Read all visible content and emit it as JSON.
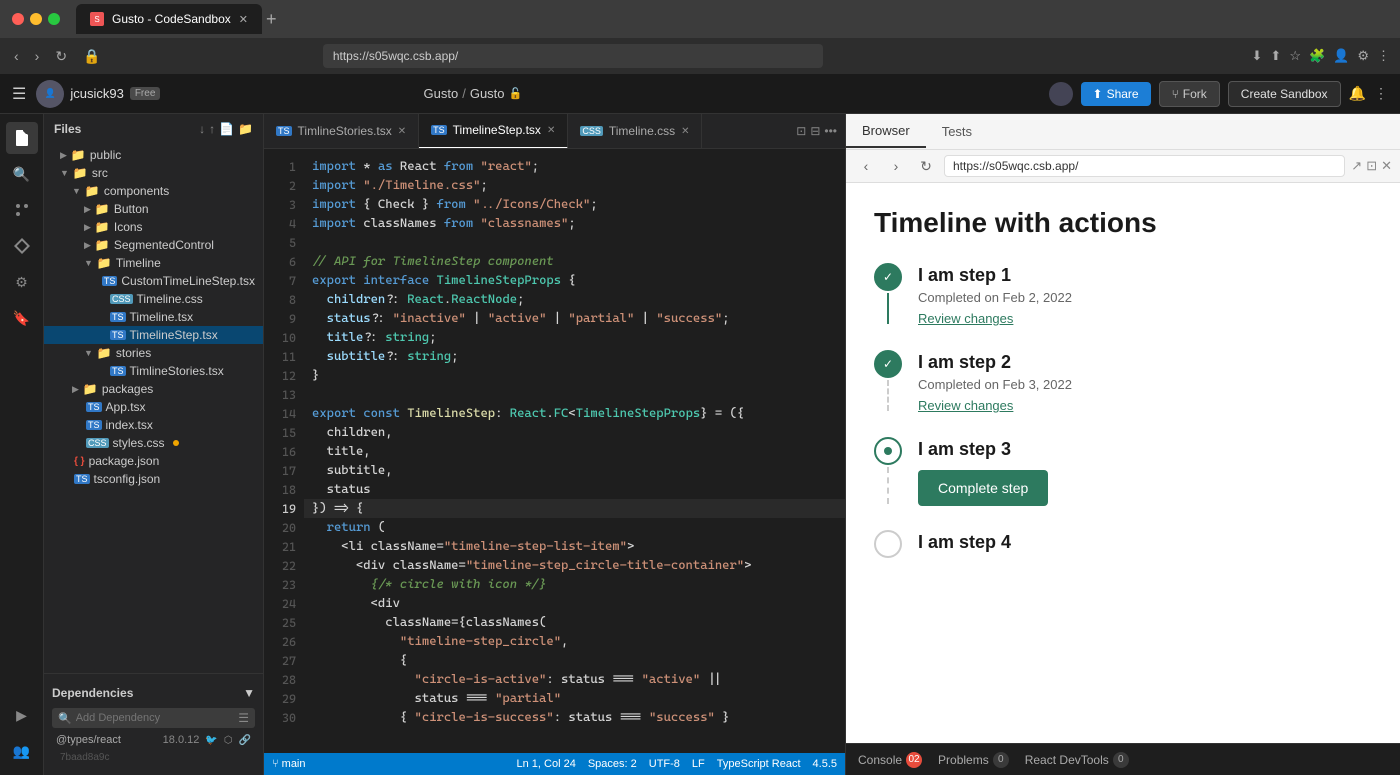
{
  "browser_chrome": {
    "traffic_lights": [
      "red",
      "yellow",
      "green"
    ],
    "tab_title": "Gusto - CodeSandbox",
    "new_tab_label": "+"
  },
  "nav_bar": {
    "url": "https://s05wqc.csb.app/"
  },
  "app_header": {
    "username": "jcusick93",
    "free_badge": "Free",
    "title_left": "Gusto",
    "title_separator": "/",
    "title_right": "Gusto",
    "share_label": "Share",
    "fork_label": "Fork",
    "create_sandbox_label": "Create Sandbox"
  },
  "file_panel": {
    "title": "Files",
    "folders": [
      {
        "name": "public",
        "indent": 1,
        "type": "folder"
      },
      {
        "name": "src",
        "indent": 1,
        "type": "folder",
        "expanded": true
      },
      {
        "name": "components",
        "indent": 2,
        "type": "folder",
        "expanded": true
      },
      {
        "name": "Button",
        "indent": 3,
        "type": "folder"
      },
      {
        "name": "Icons",
        "indent": 3,
        "type": "folder"
      },
      {
        "name": "SegmentedControl",
        "indent": 3,
        "type": "folder"
      },
      {
        "name": "Timeline",
        "indent": 3,
        "type": "folder",
        "expanded": true
      },
      {
        "name": "CustomTimeLineStep.tsx",
        "indent": 4,
        "type": "tsx"
      },
      {
        "name": "Timeline.css",
        "indent": 4,
        "type": "css"
      },
      {
        "name": "Timeline.tsx",
        "indent": 4,
        "type": "tsx"
      },
      {
        "name": "TimelineStep.tsx",
        "indent": 4,
        "type": "tsx",
        "active": true
      },
      {
        "name": "stories",
        "indent": 3,
        "type": "folder",
        "expanded": true
      },
      {
        "name": "TimlineStories.tsx",
        "indent": 4,
        "type": "tsx"
      },
      {
        "name": "packages",
        "indent": 2,
        "type": "folder"
      },
      {
        "name": "App.tsx",
        "indent": 2,
        "type": "tsx"
      },
      {
        "name": "index.tsx",
        "indent": 2,
        "type": "tsx"
      },
      {
        "name": "styles.css",
        "indent": 2,
        "type": "css",
        "dot": true
      }
    ],
    "root_files": [
      {
        "name": "package.json",
        "indent": 1,
        "type": "json"
      },
      {
        "name": "tsconfig.json",
        "indent": 1,
        "type": "json"
      }
    ],
    "dependencies_title": "Dependencies",
    "add_dependency_placeholder": "Add Dependency",
    "dependency_items": [
      {
        "name": "@types/react",
        "version": "18.0.12"
      }
    ],
    "commit_hash": "7baad8a9c"
  },
  "editor_tabs": [
    {
      "name": "TimlineStories.tsx",
      "type": "tsx",
      "active": false,
      "modified": false
    },
    {
      "name": "TimelineStep.tsx",
      "type": "tsx",
      "active": true,
      "modified": false
    },
    {
      "name": "Timeline.css",
      "type": "css",
      "active": false,
      "modified": false
    }
  ],
  "code_lines": [
    {
      "num": 1,
      "tokens": [
        {
          "t": "kw",
          "v": "import"
        },
        {
          "t": "plain",
          "v": " * "
        },
        {
          "t": "kw",
          "v": "as"
        },
        {
          "t": "plain",
          "v": " React "
        },
        {
          "t": "kw",
          "v": "from"
        },
        {
          "t": "plain",
          "v": " "
        },
        {
          "t": "str",
          "v": "\"react\""
        },
        {
          "t": "plain",
          "v": ";"
        }
      ]
    },
    {
      "num": 2,
      "tokens": [
        {
          "t": "kw",
          "v": "import"
        },
        {
          "t": "plain",
          "v": " "
        },
        {
          "t": "str",
          "v": "\"./Timeline.css\""
        },
        {
          "t": "plain",
          "v": ";"
        }
      ]
    },
    {
      "num": 3,
      "tokens": [
        {
          "t": "kw",
          "v": "import"
        },
        {
          "t": "plain",
          "v": " { Check } "
        },
        {
          "t": "kw",
          "v": "from"
        },
        {
          "t": "plain",
          "v": " "
        },
        {
          "t": "str",
          "v": "\"../Icons/Check\""
        },
        {
          "t": "plain",
          "v": ";"
        }
      ]
    },
    {
      "num": 4,
      "tokens": [
        {
          "t": "kw",
          "v": "import"
        },
        {
          "t": "plain",
          "v": " classNames "
        },
        {
          "t": "kw",
          "v": "from"
        },
        {
          "t": "plain",
          "v": " "
        },
        {
          "t": "str",
          "v": "\"classnames\""
        },
        {
          "t": "plain",
          "v": ";"
        }
      ]
    },
    {
      "num": 5,
      "tokens": []
    },
    {
      "num": 6,
      "tokens": [
        {
          "t": "cm",
          "v": "// API for TimelineStep component"
        }
      ]
    },
    {
      "num": 7,
      "tokens": [
        {
          "t": "kw",
          "v": "export"
        },
        {
          "t": "plain",
          "v": " "
        },
        {
          "t": "kw",
          "v": "interface"
        },
        {
          "t": "plain",
          "v": " "
        },
        {
          "t": "type",
          "v": "TimelineStepProps"
        },
        {
          "t": "plain",
          "v": " {"
        }
      ]
    },
    {
      "num": 8,
      "tokens": [
        {
          "t": "plain",
          "v": "  "
        },
        {
          "t": "prop",
          "v": "children"
        },
        {
          "t": "plain",
          "v": "?: "
        },
        {
          "t": "type",
          "v": "React"
        },
        {
          "t": "plain",
          "v": "."
        },
        {
          "t": "type",
          "v": "ReactNode"
        },
        {
          "t": "plain",
          "v": ";"
        }
      ]
    },
    {
      "num": 9,
      "tokens": [
        {
          "t": "plain",
          "v": "  "
        },
        {
          "t": "prop",
          "v": "status"
        },
        {
          "t": "plain",
          "v": "?: "
        },
        {
          "t": "str",
          "v": "\"inactive\""
        },
        {
          "t": "plain",
          "v": " | "
        },
        {
          "t": "str",
          "v": "\"active\""
        },
        {
          "t": "plain",
          "v": " | "
        },
        {
          "t": "str",
          "v": "\"partial\""
        },
        {
          "t": "plain",
          "v": " | "
        },
        {
          "t": "str",
          "v": "\"success\""
        },
        {
          "t": "plain",
          "v": ";"
        }
      ]
    },
    {
      "num": 10,
      "tokens": [
        {
          "t": "plain",
          "v": "  "
        },
        {
          "t": "prop",
          "v": "title"
        },
        {
          "t": "plain",
          "v": "?: "
        },
        {
          "t": "type",
          "v": "string"
        },
        {
          "t": "plain",
          "v": ";"
        }
      ]
    },
    {
      "num": 11,
      "tokens": [
        {
          "t": "plain",
          "v": "  "
        },
        {
          "t": "prop",
          "v": "subtitle"
        },
        {
          "t": "plain",
          "v": "?: "
        },
        {
          "t": "type",
          "v": "string"
        },
        {
          "t": "plain",
          "v": ";"
        }
      ]
    },
    {
      "num": 12,
      "tokens": [
        {
          "t": "plain",
          "v": "}"
        }
      ]
    },
    {
      "num": 13,
      "tokens": []
    },
    {
      "num": 14,
      "tokens": [
        {
          "t": "kw",
          "v": "export"
        },
        {
          "t": "plain",
          "v": " "
        },
        {
          "t": "kw",
          "v": "const"
        },
        {
          "t": "plain",
          "v": " "
        },
        {
          "t": "fn",
          "v": "TimelineStep"
        },
        {
          "t": "plain",
          "v": ": "
        },
        {
          "t": "type",
          "v": "React"
        },
        {
          "t": "plain",
          "v": "."
        },
        {
          "t": "type",
          "v": "FC"
        },
        {
          "t": "plain",
          "v": "<"
        },
        {
          "t": "type",
          "v": "TimelineStepProps"
        },
        {
          "t": "plain",
          "v": "} = ({"
        }
      ]
    },
    {
      "num": 15,
      "tokens": [
        {
          "t": "plain",
          "v": "  children,"
        }
      ]
    },
    {
      "num": 16,
      "tokens": [
        {
          "t": "plain",
          "v": "  title,"
        }
      ]
    },
    {
      "num": 17,
      "tokens": [
        {
          "t": "plain",
          "v": "  subtitle,"
        }
      ]
    },
    {
      "num": 18,
      "tokens": [
        {
          "t": "plain",
          "v": "  status"
        }
      ]
    },
    {
      "num": 19,
      "tokens": [
        {
          "t": "plain",
          "v": "}) => {"
        }
      ]
    },
    {
      "num": 20,
      "tokens": [
        {
          "t": "plain",
          "v": "  "
        },
        {
          "t": "kw",
          "v": "return"
        },
        {
          "t": "plain",
          "v": " ("
        }
      ]
    },
    {
      "num": 21,
      "tokens": [
        {
          "t": "plain",
          "v": "    <li className="
        },
        {
          "t": "str",
          "v": "\"timeline-step-list-item\""
        },
        {
          "t": "plain",
          "v": ">"
        }
      ]
    },
    {
      "num": 22,
      "tokens": [
        {
          "t": "plain",
          "v": "      <div className="
        },
        {
          "t": "str",
          "v": "\"timeline-step_circle-title-container\""
        },
        {
          "t": "plain",
          "v": ">"
        }
      ]
    },
    {
      "num": 23,
      "tokens": [
        {
          "t": "plain",
          "v": "        "
        },
        {
          "t": "cm",
          "v": "{/* circle with icon */}"
        }
      ]
    },
    {
      "num": 24,
      "tokens": [
        {
          "t": "plain",
          "v": "        <div"
        }
      ]
    },
    {
      "num": 25,
      "tokens": [
        {
          "t": "plain",
          "v": "          className={classNames("
        }
      ]
    },
    {
      "num": 26,
      "tokens": [
        {
          "t": "plain",
          "v": "            "
        },
        {
          "t": "str",
          "v": "\"timeline-step_circle\""
        },
        {
          "t": "plain",
          "v": ","
        }
      ]
    },
    {
      "num": 27,
      "tokens": [
        {
          "t": "plain",
          "v": "            {"
        }
      ]
    },
    {
      "num": 28,
      "tokens": [
        {
          "t": "plain",
          "v": "              "
        },
        {
          "t": "str",
          "v": "\"circle-is-active\""
        },
        {
          "t": "plain",
          "v": ": status === "
        },
        {
          "t": "str",
          "v": "\"active\""
        },
        {
          "t": "plain",
          "v": " ||"
        }
      ]
    },
    {
      "num": 29,
      "tokens": [
        {
          "t": "plain",
          "v": "              status === "
        },
        {
          "t": "str",
          "v": "\"partial\""
        }
      ]
    },
    {
      "num": 30,
      "tokens": [
        {
          "t": "plain",
          "v": "            { "
        },
        {
          "t": "str",
          "v": "\"circle-is-success\""
        },
        {
          "t": "plain",
          "v": ": status === "
        },
        {
          "t": "str",
          "v": "\"success\""
        },
        {
          "t": "plain",
          "v": " }"
        }
      ]
    }
  ],
  "active_line": 19,
  "status_bar": {
    "branch": "Ln 1, Col 24",
    "spaces": "Spaces: 2",
    "encoding": "UTF-8",
    "line_ending": "LF",
    "language": "TypeScript React",
    "version": "4.5.5"
  },
  "browser_panel": {
    "tabs": [
      "Browser",
      "Tests"
    ],
    "active_tab": "Browser",
    "url": "https://s05wqc.csb.app/",
    "title": "Timeline with actions",
    "steps": [
      {
        "num": 1,
        "title": "I am step 1",
        "subtitle": "Completed on Feb 2, 2022",
        "status": "success",
        "action_label": "Review changes",
        "action_type": "link"
      },
      {
        "num": 2,
        "title": "I am step 2",
        "subtitle": "Completed on Feb 3, 2022",
        "status": "success",
        "action_label": "Review changes",
        "action_type": "link"
      },
      {
        "num": 3,
        "title": "I am step 3",
        "subtitle": "",
        "status": "active",
        "action_label": "Complete step",
        "action_type": "button"
      },
      {
        "num": 4,
        "title": "I am step 4",
        "subtitle": "",
        "status": "inactive",
        "action_label": "",
        "action_type": "none"
      }
    ]
  },
  "console_bar": {
    "console_label": "Console",
    "console_count": "02",
    "problems_label": "Problems",
    "problems_count": "0",
    "devtools_label": "React DevTools",
    "devtools_count": "0"
  }
}
